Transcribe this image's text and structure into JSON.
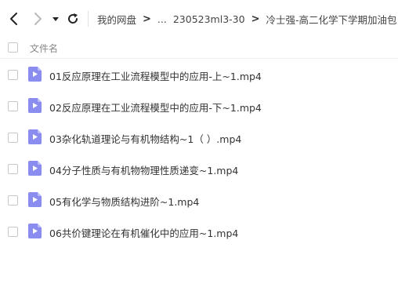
{
  "toolbar": {
    "icons": {
      "back": "arrow-left-icon",
      "forward": "arrow-right-icon",
      "dropdown": "caret-down-icon",
      "refresh": "refresh-icon"
    },
    "breadcrumb": [
      "我的网盘",
      "...",
      "230523ml3-30",
      "冷士强-高二化学下学期加油包（ ）"
    ]
  },
  "list": {
    "header": "文件名",
    "files": [
      {
        "name": "01反应原理在工业流程模型中的应用-上~1.mp4",
        "icon": "video-file-icon"
      },
      {
        "name": "02反应原理在工业流程模型中的应用-下~1.mp4",
        "icon": "video-file-icon"
      },
      {
        "name": "03杂化轨道理论与有机物结构~1（ ）.mp4",
        "icon": "video-file-icon"
      },
      {
        "name": "04分子性质与有机物物理性质递变~1.mp4",
        "icon": "video-file-icon"
      },
      {
        "name": "05有化学与物质结构进阶~1.mp4",
        "icon": "video-file-icon"
      },
      {
        "name": "06共价键理论在有机催化中的应用~1.mp4",
        "icon": "video-file-icon"
      }
    ]
  },
  "colors": {
    "video_icon": "#8a8cf0",
    "video_icon_fold": "#b8baf7"
  }
}
